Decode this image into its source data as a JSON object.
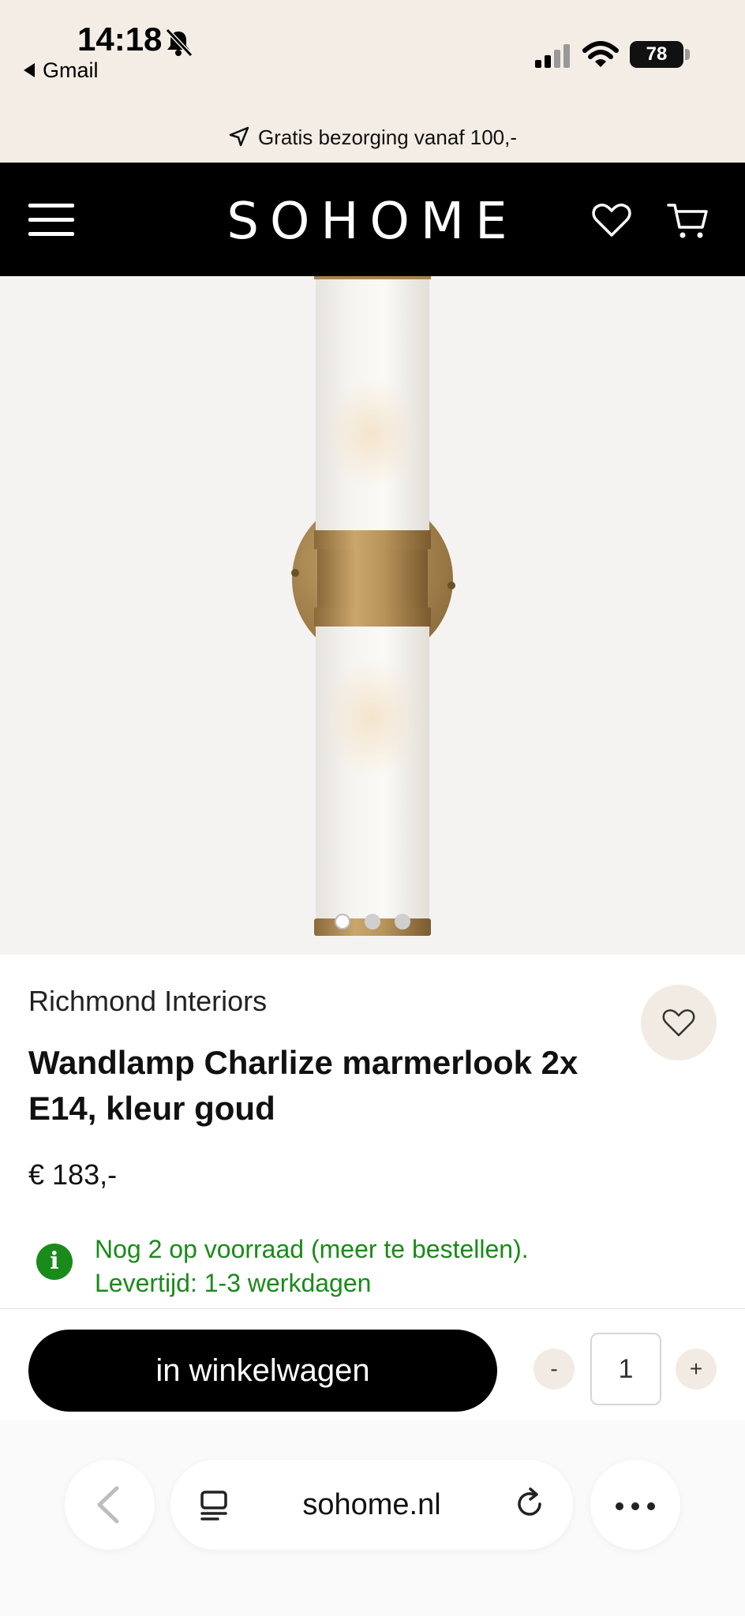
{
  "status_bar": {
    "time": "14:18",
    "back_app": "Gmail",
    "battery": "78"
  },
  "promo": {
    "text": "Gratis bezorging vanaf 100,-"
  },
  "header": {
    "logo": "SOHOME"
  },
  "gallery": {
    "image_count": 3,
    "active_index": 0
  },
  "product": {
    "brand": "Richmond Interiors",
    "title": "Wandlamp Charlize marmerlook 2x E14, kleur goud",
    "price": "€ 183,-",
    "stock_icon": "i",
    "stock_line1": "Nog 2 op voorraad (meer te bestellen).",
    "stock_line2": "Levertijd: 1-3 werkdagen"
  },
  "buy": {
    "cart_label": "in winkelwagen",
    "minus": "-",
    "plus": "+",
    "quantity": "1"
  },
  "browser": {
    "url": "sohome.nl"
  },
  "colors": {
    "header_bg": "#000000",
    "promo_bg": "#f4ede6",
    "stock_green": "#1a8a1a",
    "gold": "#b8935a"
  }
}
